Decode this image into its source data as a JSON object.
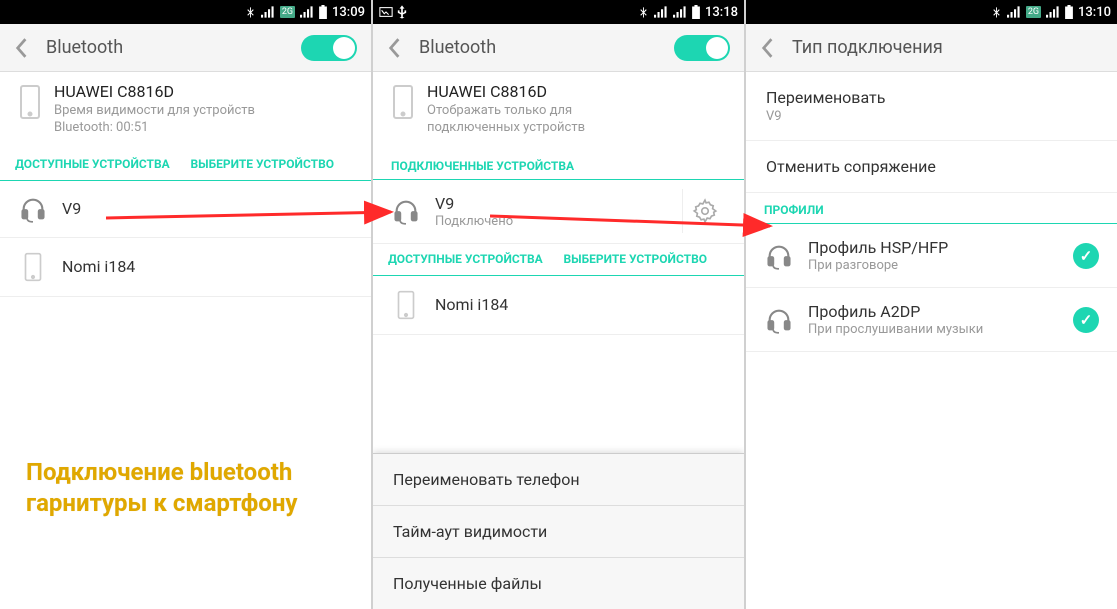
{
  "colors": {
    "accent": "#1dd6b2",
    "captionColor": "#e0a800",
    "arrow": "#ff2a2a"
  },
  "caption": "Подключение bluetooth\nгарнитуры к смартфону",
  "phones": [
    {
      "status_time": "13:09",
      "title": "Bluetooth",
      "toggle_on": true,
      "self_device": {
        "name": "HUAWEI C8816D",
        "sub1": "Время видимости для устройств",
        "sub2": "Bluetooth: 00:51"
      },
      "tabs": [
        "ДОСТУПНЫЕ УСТРОЙСТВА",
        "ВЫБЕРИТЕ УСТРОЙСТВО"
      ],
      "rows": [
        {
          "icon": "headphones",
          "title": "V9"
        },
        {
          "icon": "phone",
          "title": "Nomi i184"
        }
      ]
    },
    {
      "status_time": "13:18",
      "title": "Bluetooth",
      "toggle_on": true,
      "self_device": {
        "name": "HUAWEI C8816D",
        "sub1": "Отображать только для",
        "sub2": "подключенных устройств"
      },
      "section_label": "ПОДКЛЮЧЕННЫЕ УСТРОЙСТВА",
      "connected": {
        "icon": "headphones",
        "title": "V9",
        "sub": "Подключено"
      },
      "tabs": [
        "ДОСТУПНЫЕ УСТРОЙСТВА",
        "ВЫБЕРИТЕ УСТРОЙСТВО"
      ],
      "rows": [
        {
          "icon": "phone",
          "title": "Nomi i184"
        }
      ],
      "bottom_menu": [
        "Переименовать телефон",
        "Тайм-аут видимости",
        "Полученные файлы"
      ]
    },
    {
      "status_time": "13:10",
      "title": "Тип подключения",
      "items": [
        {
          "title": "Переименовать",
          "sub": "V9"
        },
        {
          "title": "Отменить сопряжение"
        }
      ],
      "section_label": "ПРОФИЛИ",
      "profiles": [
        {
          "title": "Профиль HSP/HFP",
          "sub": "При разговоре",
          "checked": true
        },
        {
          "title": "Профиль A2DP",
          "sub": "При прослушивании музыки",
          "checked": true
        }
      ]
    }
  ]
}
